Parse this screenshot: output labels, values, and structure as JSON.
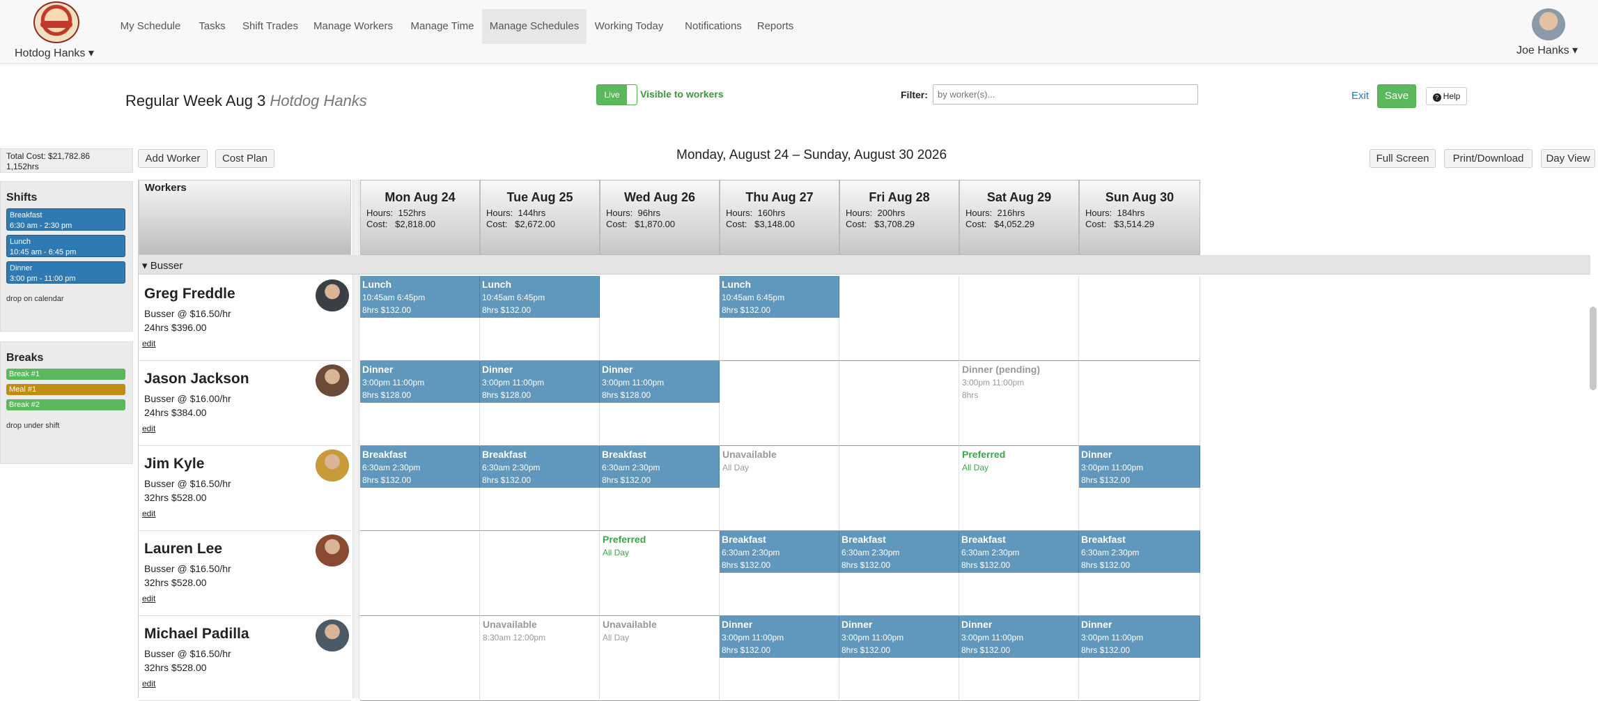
{
  "company": "Hotdog Hanks ▾",
  "user": "Joe Hanks ▾",
  "nav": [
    "My Schedule",
    "Tasks",
    "Shift Trades",
    "Manage Workers",
    "Manage Time",
    "Manage Schedules",
    "Working Today",
    "Notifications",
    "Reports"
  ],
  "title": {
    "main": "Regular Week Aug 3",
    "sub": "Hotdog Hanks"
  },
  "live_label": "Live",
  "visible_label": "Visible to workers",
  "filter": {
    "label": "Filter:",
    "placeholder": "by worker(s)..."
  },
  "exit": "Exit",
  "save": "Save",
  "help": "Help",
  "totals": {
    "cost": "Total Cost: $21,782.86",
    "hours": "1,152hrs"
  },
  "buttons": {
    "add_worker": "Add Worker",
    "cost_plan": "Cost Plan",
    "full_screen": "Full Screen",
    "print": "Print/Download",
    "day_view": "Day View"
  },
  "date_range": "Monday, August 24 – Sunday, August 30 2026",
  "shifts_panel": {
    "title": "Shifts",
    "items": [
      "Breakfast\n6:30 am - 2:30 pm",
      "Lunch\n10:45 am - 6:45 pm",
      "Dinner\n3:00 pm - 11:00 pm"
    ],
    "hint": "drop on calendar"
  },
  "breaks_panel": {
    "title": "Breaks",
    "items": [
      "Break #1",
      "Meal #1",
      "Break #2"
    ],
    "hint": "drop under shift"
  },
  "workers_header": "Workers",
  "group": "▾ Busser",
  "days": [
    {
      "name": "Mon Aug 24",
      "stats": "Hours:  152hrs\nCost:   $2,818.00"
    },
    {
      "name": "Tue Aug 25",
      "stats": "Hours:  144hrs\nCost:   $2,672.00"
    },
    {
      "name": "Wed Aug 26",
      "stats": "Hours:  96hrs\nCost:   $1,870.00"
    },
    {
      "name": "Thu Aug 27",
      "stats": "Hours:  160hrs\nCost:   $3,148.00"
    },
    {
      "name": "Fri Aug 28",
      "stats": "Hours:  200hrs\nCost:   $3,708.29"
    },
    {
      "name": "Sat Aug 29",
      "stats": "Hours:  216hrs\nCost:   $4,052.29"
    },
    {
      "name": "Sun Aug 30",
      "stats": "Hours:  184hrs\nCost:   $3,514.29"
    }
  ],
  "workers": [
    {
      "name": "Greg Freddle",
      "rate": "Busser @ $16.50/hr",
      "hours": "24hrs $396.00",
      "edit": "edit",
      "photo_color": "#3b3f46",
      "cells": [
        {
          "type": "shift",
          "title": "Lunch",
          "time": "10:45am 6:45pm",
          "info": "8hrs $132.00"
        },
        {
          "type": "shift",
          "title": "Lunch",
          "time": "10:45am 6:45pm",
          "info": "8hrs $132.00"
        },
        null,
        {
          "type": "shift",
          "title": "Lunch",
          "time": "10:45am 6:45pm",
          "info": "8hrs $132.00"
        },
        null,
        null,
        null
      ]
    },
    {
      "name": "Jason Jackson",
      "rate": "Busser @ $16.00/hr",
      "hours": "24hrs $384.00",
      "edit": "edit",
      "photo_color": "#6b4a3a",
      "cells": [
        {
          "type": "shift",
          "title": "Dinner",
          "time": "3:00pm 11:00pm",
          "info": "8hrs $128.00"
        },
        {
          "type": "shift",
          "title": "Dinner",
          "time": "3:00pm 11:00pm",
          "info": "8hrs $128.00"
        },
        {
          "type": "shift",
          "title": "Dinner",
          "time": "3:00pm 11:00pm",
          "info": "8hrs $128.00"
        },
        null,
        null,
        {
          "type": "pending",
          "title": "Dinner (pending)",
          "time": "3:00pm 11:00pm",
          "info": "8hrs"
        },
        null
      ]
    },
    {
      "name": "Jim Kyle",
      "rate": "Busser @ $16.50/hr",
      "hours": "32hrs $528.00",
      "edit": "edit",
      "photo_color": "#c89b3a",
      "cells": [
        {
          "type": "shift",
          "title": "Breakfast",
          "time": "6:30am 2:30pm",
          "info": "8hrs $132.00"
        },
        {
          "type": "shift",
          "title": "Breakfast",
          "time": "6:30am 2:30pm",
          "info": "8hrs $132.00"
        },
        {
          "type": "shift",
          "title": "Breakfast",
          "time": "6:30am 2:30pm",
          "info": "8hrs $132.00"
        },
        {
          "type": "unavail",
          "title": "Unavailable",
          "time": "All Day"
        },
        null,
        {
          "type": "pref",
          "title": "Preferred",
          "time": "All Day"
        },
        {
          "type": "shift",
          "title": "Dinner",
          "time": "3:00pm 11:00pm",
          "info": "8hrs $132.00"
        }
      ]
    },
    {
      "name": "Lauren Lee",
      "rate": "Busser @ $16.50/hr",
      "hours": "32hrs $528.00",
      "edit": "edit",
      "photo_color": "#8a4a32",
      "cells": [
        null,
        null,
        {
          "type": "pref",
          "title": "Preferred",
          "time": "All Day"
        },
        {
          "type": "shift",
          "title": "Breakfast",
          "time": "6:30am 2:30pm",
          "info": "8hrs $132.00"
        },
        {
          "type": "shift",
          "title": "Breakfast",
          "time": "6:30am 2:30pm",
          "info": "8hrs $132.00"
        },
        {
          "type": "shift",
          "title": "Breakfast",
          "time": "6:30am 2:30pm",
          "info": "8hrs $132.00"
        },
        {
          "type": "shift",
          "title": "Breakfast",
          "time": "6:30am 2:30pm",
          "info": "8hrs $132.00"
        }
      ]
    },
    {
      "name": "Michael Padilla",
      "rate": "Busser @ $16.50/hr",
      "hours": "32hrs $528.00",
      "edit": "edit",
      "photo_color": "#4a5a66",
      "cells": [
        null,
        {
          "type": "unavail",
          "title": "Unavailable",
          "time": "8:30am 12:00pm"
        },
        {
          "type": "unavail",
          "title": "Unavailable",
          "time": "All Day"
        },
        {
          "type": "shift",
          "title": "Dinner",
          "time": "3:00pm 11:00pm",
          "info": "8hrs $132.00"
        },
        {
          "type": "shift",
          "title": "Dinner",
          "time": "3:00pm 11:00pm",
          "info": "8hrs $132.00"
        },
        {
          "type": "shift",
          "title": "Dinner",
          "time": "3:00pm 11:00pm",
          "info": "8hrs $132.00"
        },
        {
          "type": "shift",
          "title": "Dinner",
          "time": "3:00pm 11:00pm",
          "info": "8hrs $132.00"
        }
      ]
    }
  ]
}
